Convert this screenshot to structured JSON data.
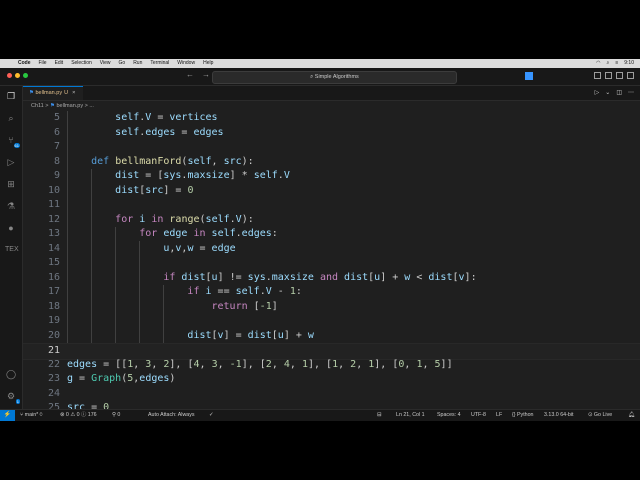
{
  "menubar": {
    "app": "Code",
    "items": [
      "File",
      "Edit",
      "Selection",
      "View",
      "Go",
      "Run",
      "Terminal",
      "Window",
      "Help"
    ],
    "clock": "9:10"
  },
  "titlebar": {
    "command_center": "Simple Algorithms",
    "back": "←",
    "forward": "→"
  },
  "activity_bar": {
    "scm_badge": "61",
    "settings_badge": "1"
  },
  "tab": {
    "filename": "bellman.py",
    "status": "U",
    "close": "×"
  },
  "breadcrumb": {
    "folder": "Ch11",
    "sep": ">",
    "file": "bellman.py",
    "more": "> ..."
  },
  "code_lines": [
    {
      "n": "5",
      "t": "            self.V = vertices"
    },
    {
      "n": "6",
      "t": "            self.edges = edges"
    },
    {
      "n": "7",
      "t": ""
    },
    {
      "n": "8",
      "t": "        def bellmanFord(self, src):"
    },
    {
      "n": "9",
      "t": "            dist = [sys.maxsize] * self.V"
    },
    {
      "n": "10",
      "t": "            dist[src] = 0"
    },
    {
      "n": "11",
      "t": ""
    },
    {
      "n": "12",
      "t": "            for i in range(self.V):"
    },
    {
      "n": "13",
      "t": "                for edge in self.edges:"
    },
    {
      "n": "14",
      "t": "                    u,v,w = edge"
    },
    {
      "n": "15",
      "t": ""
    },
    {
      "n": "16",
      "t": "                    if dist[u] != sys.maxsize and dist[u] + w < dist[v]:"
    },
    {
      "n": "17",
      "t": "                        if i == self.V - 1:"
    },
    {
      "n": "18",
      "t": "                            return [-1]"
    },
    {
      "n": "19",
      "t": ""
    },
    {
      "n": "20",
      "t": "                        dist[v] = dist[u] + w"
    },
    {
      "n": "21",
      "t": ""
    },
    {
      "n": "22",
      "t": "    edges = [[1, 3, 2], [4, 3, -1], [2, 4, 1], [1, 2, 1], [0, 1, 5]]"
    },
    {
      "n": "23",
      "t": "    g = Graph(5,edges)"
    },
    {
      "n": "24",
      "t": ""
    },
    {
      "n": "25",
      "t": "    src = 0"
    }
  ],
  "status": {
    "branch": "main*",
    "errors": "0",
    "warnings": "0",
    "info": "176",
    "ports": "0",
    "auto_attach": "Auto Attach: Always",
    "position": "Ln 21, Col 1",
    "spaces": "Spaces: 4",
    "encoding": "UTF-8",
    "eol": "LF",
    "language": "Python",
    "interpreter": "3.13.0 64-bit",
    "golive": "Go Live"
  }
}
